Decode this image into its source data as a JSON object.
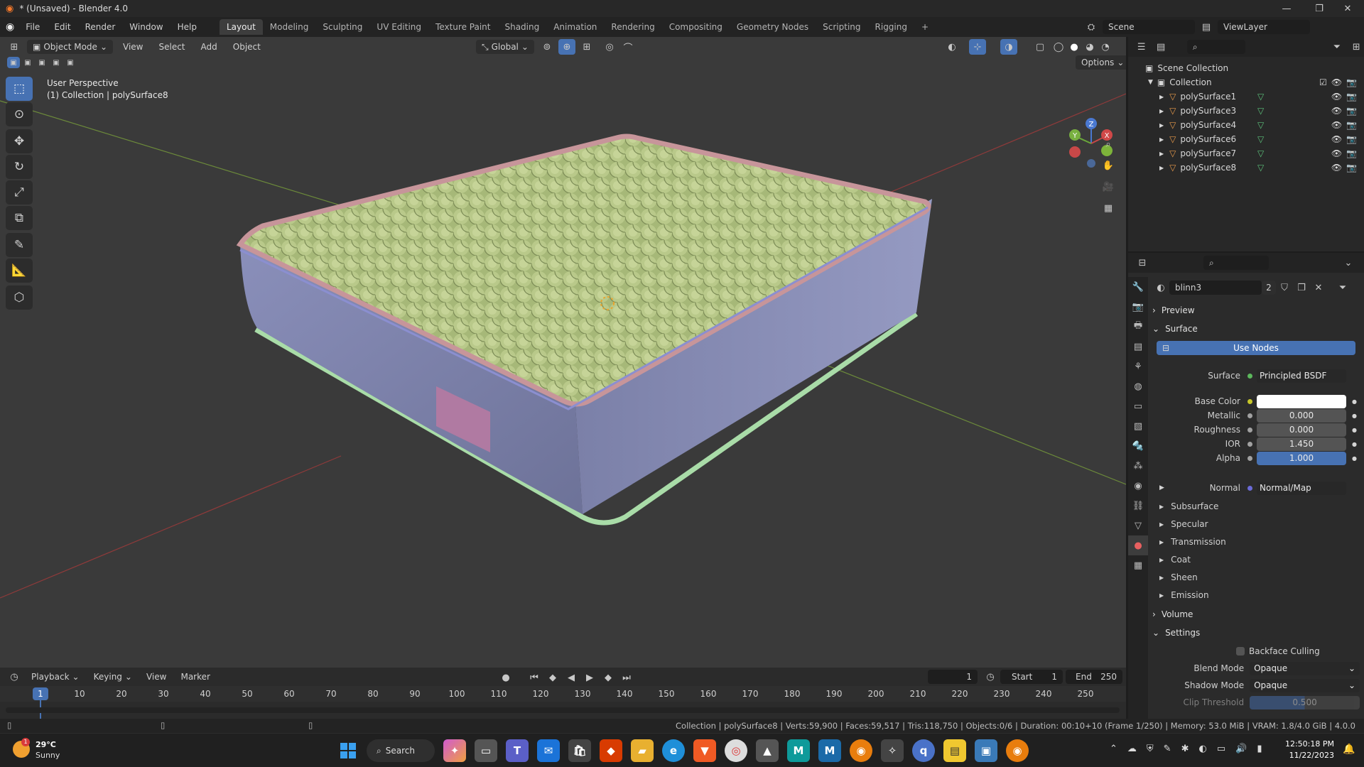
{
  "window": {
    "title": "* (Unsaved) - Blender 4.0",
    "controls": [
      "—",
      "❐",
      "✕"
    ]
  },
  "menus": [
    "File",
    "Edit",
    "Render",
    "Window",
    "Help"
  ],
  "workspaces": [
    "Layout",
    "Modeling",
    "Sculpting",
    "UV Editing",
    "Texture Paint",
    "Shading",
    "Animation",
    "Rendering",
    "Compositing",
    "Geometry Nodes",
    "Scripting",
    "Rigging"
  ],
  "workspace_active": "Layout",
  "scene": {
    "name": "Scene",
    "view_layer": "ViewLayer"
  },
  "viewport": {
    "mode": "Object Mode",
    "menus": [
      "View",
      "Select",
      "Add",
      "Object"
    ],
    "transform_orientation": "Global",
    "options_label": "Options",
    "info_line1": "User Perspective",
    "info_line2": "(1) Collection | polySurface8",
    "gizmo": {
      "z": "Z",
      "y": "Y",
      "x": "X"
    }
  },
  "outliner": {
    "root": "Scene Collection",
    "collection": "Collection",
    "items": [
      "polySurface1",
      "polySurface3",
      "polySurface4",
      "polySurface6",
      "polySurface7",
      "polySurface8"
    ]
  },
  "properties": {
    "material_name": "blinn3",
    "user_count": "2",
    "panels": {
      "preview": "Preview",
      "surface": "Surface",
      "volume": "Volume",
      "settings": "Settings"
    },
    "use_nodes": "Use Nodes",
    "surface_label": "Surface",
    "surface_value": "Principled BSDF",
    "fields": [
      {
        "label": "Base Color",
        "value": "",
        "color": "#ffffff"
      },
      {
        "label": "Metallic",
        "value": "0.000"
      },
      {
        "label": "Roughness",
        "value": "0.000"
      },
      {
        "label": "IOR",
        "value": "1.450"
      },
      {
        "label": "Alpha",
        "value": "1.000"
      }
    ],
    "normal_label": "Normal",
    "normal_value": "Normal/Map",
    "subpanels": [
      "Subsurface",
      "Specular",
      "Transmission",
      "Coat",
      "Sheen",
      "Emission"
    ],
    "backface_culling": "Backface Culling",
    "blend_mode_label": "Blend Mode",
    "blend_mode": "Opaque",
    "shadow_mode_label": "Shadow Mode",
    "shadow_mode": "Opaque",
    "clip_threshold_label": "Clip Threshold",
    "clip_threshold": "0.500"
  },
  "timeline": {
    "menus": [
      "Playback",
      "Keying",
      "View",
      "Marker"
    ],
    "current_frame": "1",
    "start_label": "Start",
    "start": "1",
    "end_label": "End",
    "end": "250",
    "ticks": [
      "10",
      "20",
      "30",
      "40",
      "50",
      "60",
      "70",
      "80",
      "90",
      "100",
      "110",
      "120",
      "130",
      "140",
      "150",
      "160",
      "170",
      "180",
      "190",
      "200",
      "210",
      "220",
      "230",
      "240",
      "250"
    ]
  },
  "statusbar": {
    "text": "Collection | polySurface8 | Verts:59,900 | Faces:59,517 | Tris:118,750 | Objects:0/6 | Duration: 00:10+10 (Frame 1/250) | Memory: 53.0 MiB | VRAM: 1.8/4.0 GiB | 4.0.0"
  },
  "taskbar": {
    "weather_temp": "29°C",
    "weather_desc": "Sunny",
    "search": "Search",
    "time": "12:50:18 PM",
    "date": "11/22/2023",
    "badge": "1"
  },
  "colors": {
    "accent": "#4772b3",
    "mattress_top": "#a7b97a",
    "mattress_side": "#7a7fa8",
    "trim": "#d49a9a",
    "base_trim": "#a8d9a8"
  }
}
